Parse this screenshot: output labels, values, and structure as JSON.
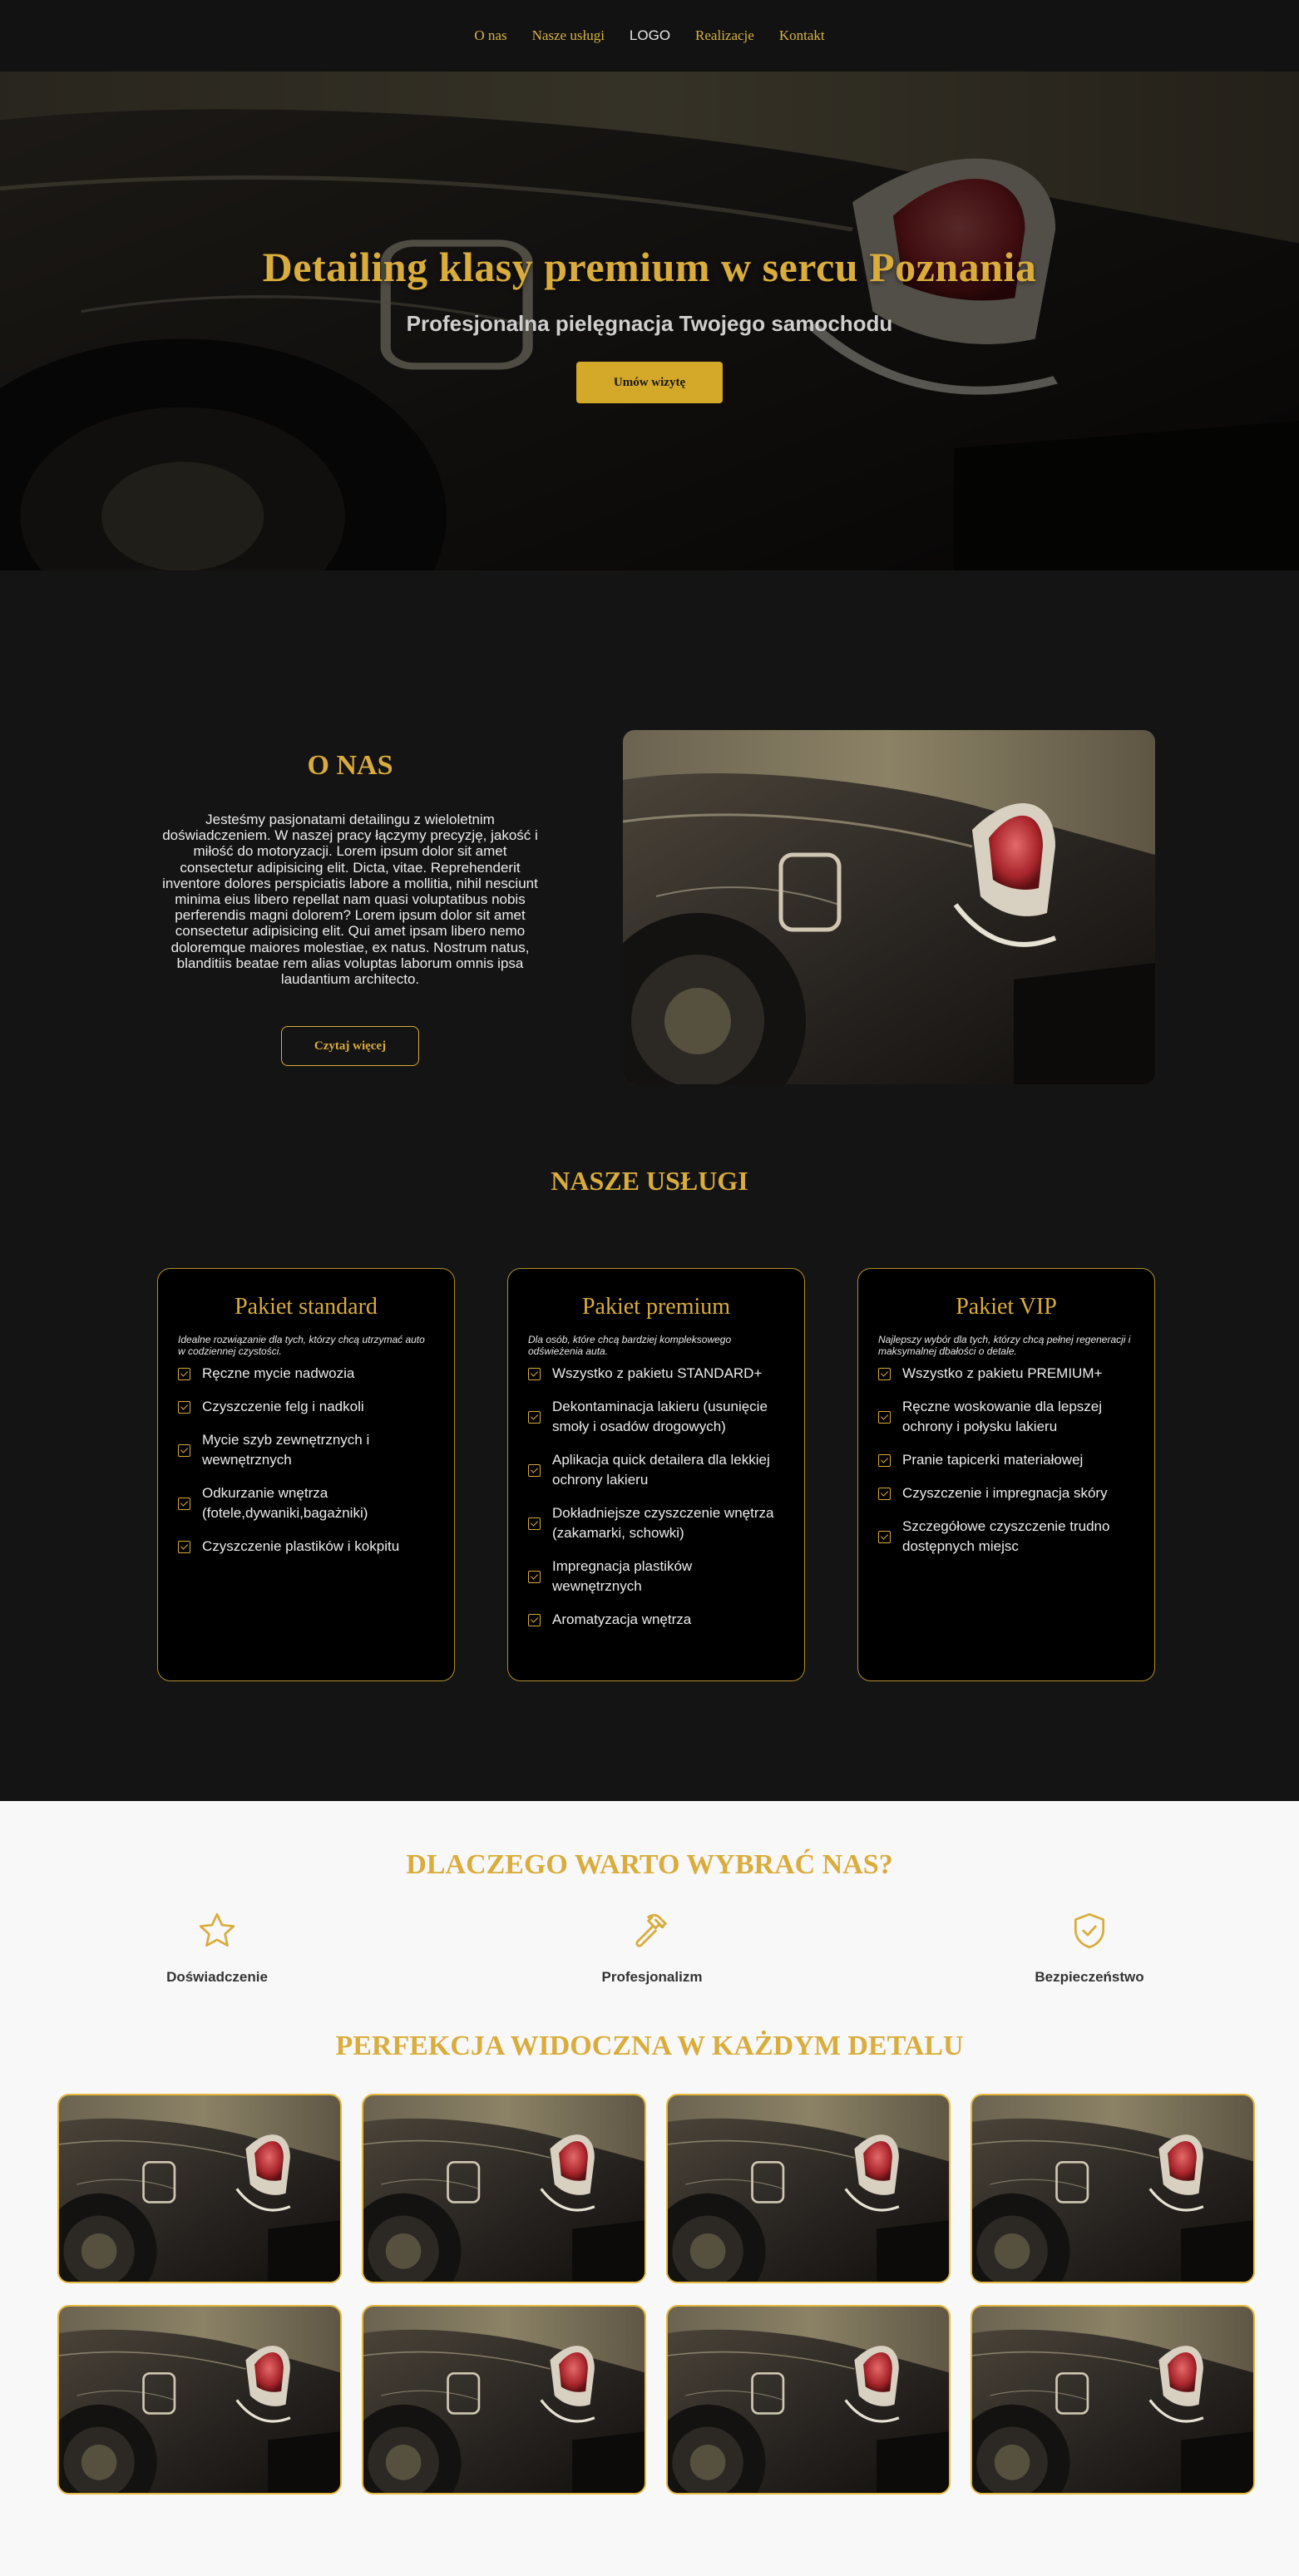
{
  "nav": {
    "items": [
      "O nas",
      "Nasze usługi",
      "LOGO",
      "Realizacje",
      "Kontakt"
    ]
  },
  "hero": {
    "title": "Detailing klasy premium w sercu Poznania",
    "subtitle": "Profesjonalna pielęgnacja Twojego samochodu",
    "cta": "Umów wizytę"
  },
  "about": {
    "title": "O NAS",
    "text": "Jesteśmy pasjonatami detailingu z wieloletnim doświadczeniem. W naszej pracy łączymy precyzję, jakość i miłość do motoryzacji. Lorem ipsum dolor sit amet consectetur adipisicing elit. Dicta, vitae. Reprehenderit inventore dolores perspiciatis labore a mollitia, nihil nesciunt minima eius libero repellat nam quasi voluptatibus nobis perferendis magni dolorem? Lorem ipsum dolor sit amet consectetur adipisicing elit. Qui amet ipsam libero nemo doloremque maiores molestiae, ex natus. Nostrum natus, blanditiis beatae rem alias voluptas laborum omnis ipsa laudantium architecto.",
    "button": "Czytaj więcej"
  },
  "services": {
    "title": "NASZE USŁUGI",
    "cards": [
      {
        "name": "Pakiet standard",
        "desc": "Idealne rozwiązanie dla tych, którzy chcą utrzymać auto w codziennej czystości.",
        "items": [
          "Ręczne mycie nadwozia",
          "Czyszczenie felg i nadkoli",
          "Mycie szyb zewnętrznych i wewnętrznych",
          "Odkurzanie wnętrza (fotele,dywaniki,bagażniki)",
          "Czyszczenie plastików i kokpitu"
        ]
      },
      {
        "name": "Pakiet premium",
        "desc": "Dla osób, które chcą bardziej kompleksowego odświeżenia auta.",
        "items": [
          "Wszystko z pakietu STANDARD+",
          "Dekontaminacja lakieru (usunięcie smoły i osadów drogowych)",
          "Aplikacja quick detailera dla lekkiej ochrony lakieru",
          "Dokładniejsze czyszczenie wnętrza (zakamarki, schowki)",
          "Impregnacja plastików wewnętrznych",
          "Aromatyzacja wnętrza"
        ]
      },
      {
        "name": "Pakiet VIP",
        "desc": "Najlepszy wybór dla tych, którzy chcą pełnej regeneracji i maksymalnej dbałości o detale.",
        "items": [
          "Wszystko z pakietu PREMIUM+",
          "Ręczne woskowanie dla lepszej ochrony i połysku lakieru",
          "Pranie tapicerki materiałowej",
          "Czyszczenie i impregnacja skóry",
          "Szczegółowe czyszczenie trudno dostępnych miejsc"
        ]
      }
    ]
  },
  "why": {
    "title": "DLACZEGO WARTO WYBRAĆ NAS?",
    "features": [
      {
        "label": "Doświadczenie",
        "icon": "star-icon"
      },
      {
        "label": "Profesjonalizm",
        "icon": "hammer-icon"
      },
      {
        "label": "Bezpieczeństwo",
        "icon": "shield-check-icon"
      }
    ]
  },
  "gallery": {
    "title": "PERFEKCJA WIDOCZNA W KAŻDYM DETALU",
    "count": 8
  },
  "colors": {
    "gold": "#d9ac3c",
    "dark_bg": "#141414",
    "light_bg": "#f8f8f8"
  }
}
